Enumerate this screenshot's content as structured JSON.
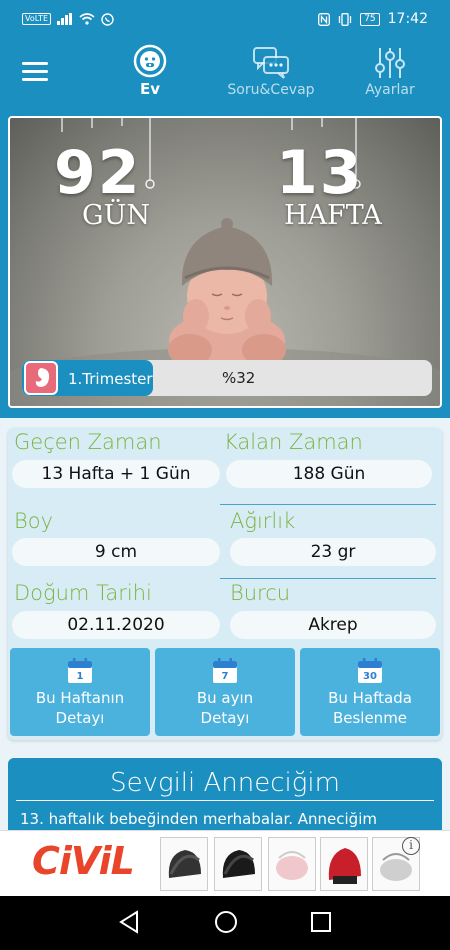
{
  "status_bar": {
    "volte": "VoLTE",
    "battery": "75",
    "time": "17:42"
  },
  "nav": {
    "tabs": [
      {
        "label": "Ev",
        "icon": "baby-face-icon",
        "active": true
      },
      {
        "label": "Soru&Cevap",
        "icon": "chat-bubbles-icon",
        "active": false
      },
      {
        "label": "Ayarlar",
        "icon": "sliders-icon",
        "active": false
      }
    ]
  },
  "hero": {
    "days_value": "92",
    "days_label": "GÜN",
    "weeks_value": "13",
    "weeks_label": "HAFTA",
    "trimester_label": "1.Trimester",
    "trimester_percent": "%32",
    "trimester_progress": 0.32
  },
  "info": {
    "elapsed_label": "Geçen Zaman",
    "elapsed_value": "13 Hafta + 1 Gün",
    "remaining_label": "Kalan Zaman",
    "remaining_value": "188 Gün",
    "height_label": "Boy",
    "height_value": "9 cm",
    "weight_label": "Ağırlık",
    "weight_value": "23 gr",
    "birth_date_label": "Doğum Tarihi",
    "birth_date_value": "02.11.2020",
    "zodiac_label": "Burcu",
    "zodiac_value": "Akrep"
  },
  "actions": [
    {
      "calendar_num": "1",
      "line1": "Bu Haftanın",
      "line2": "Detayı"
    },
    {
      "calendar_num": "7",
      "line1": "Bu ayın",
      "line2": "Detayı"
    },
    {
      "calendar_num": "30",
      "line1": "Bu Haftada",
      "line2": "Beslenme"
    }
  ],
  "message": {
    "title": "Sevgili Anneciğim",
    "text": "13. haftalık bebeğinden merhabalar. Anneciğim"
  },
  "ad": {
    "brand": "CiViL",
    "info_glyph": "i"
  },
  "colors": {
    "primary": "#1b8fbf",
    "accent_green": "#7cb342",
    "button_blue": "#4ab2dc",
    "card_bg": "#d7ecf4"
  }
}
